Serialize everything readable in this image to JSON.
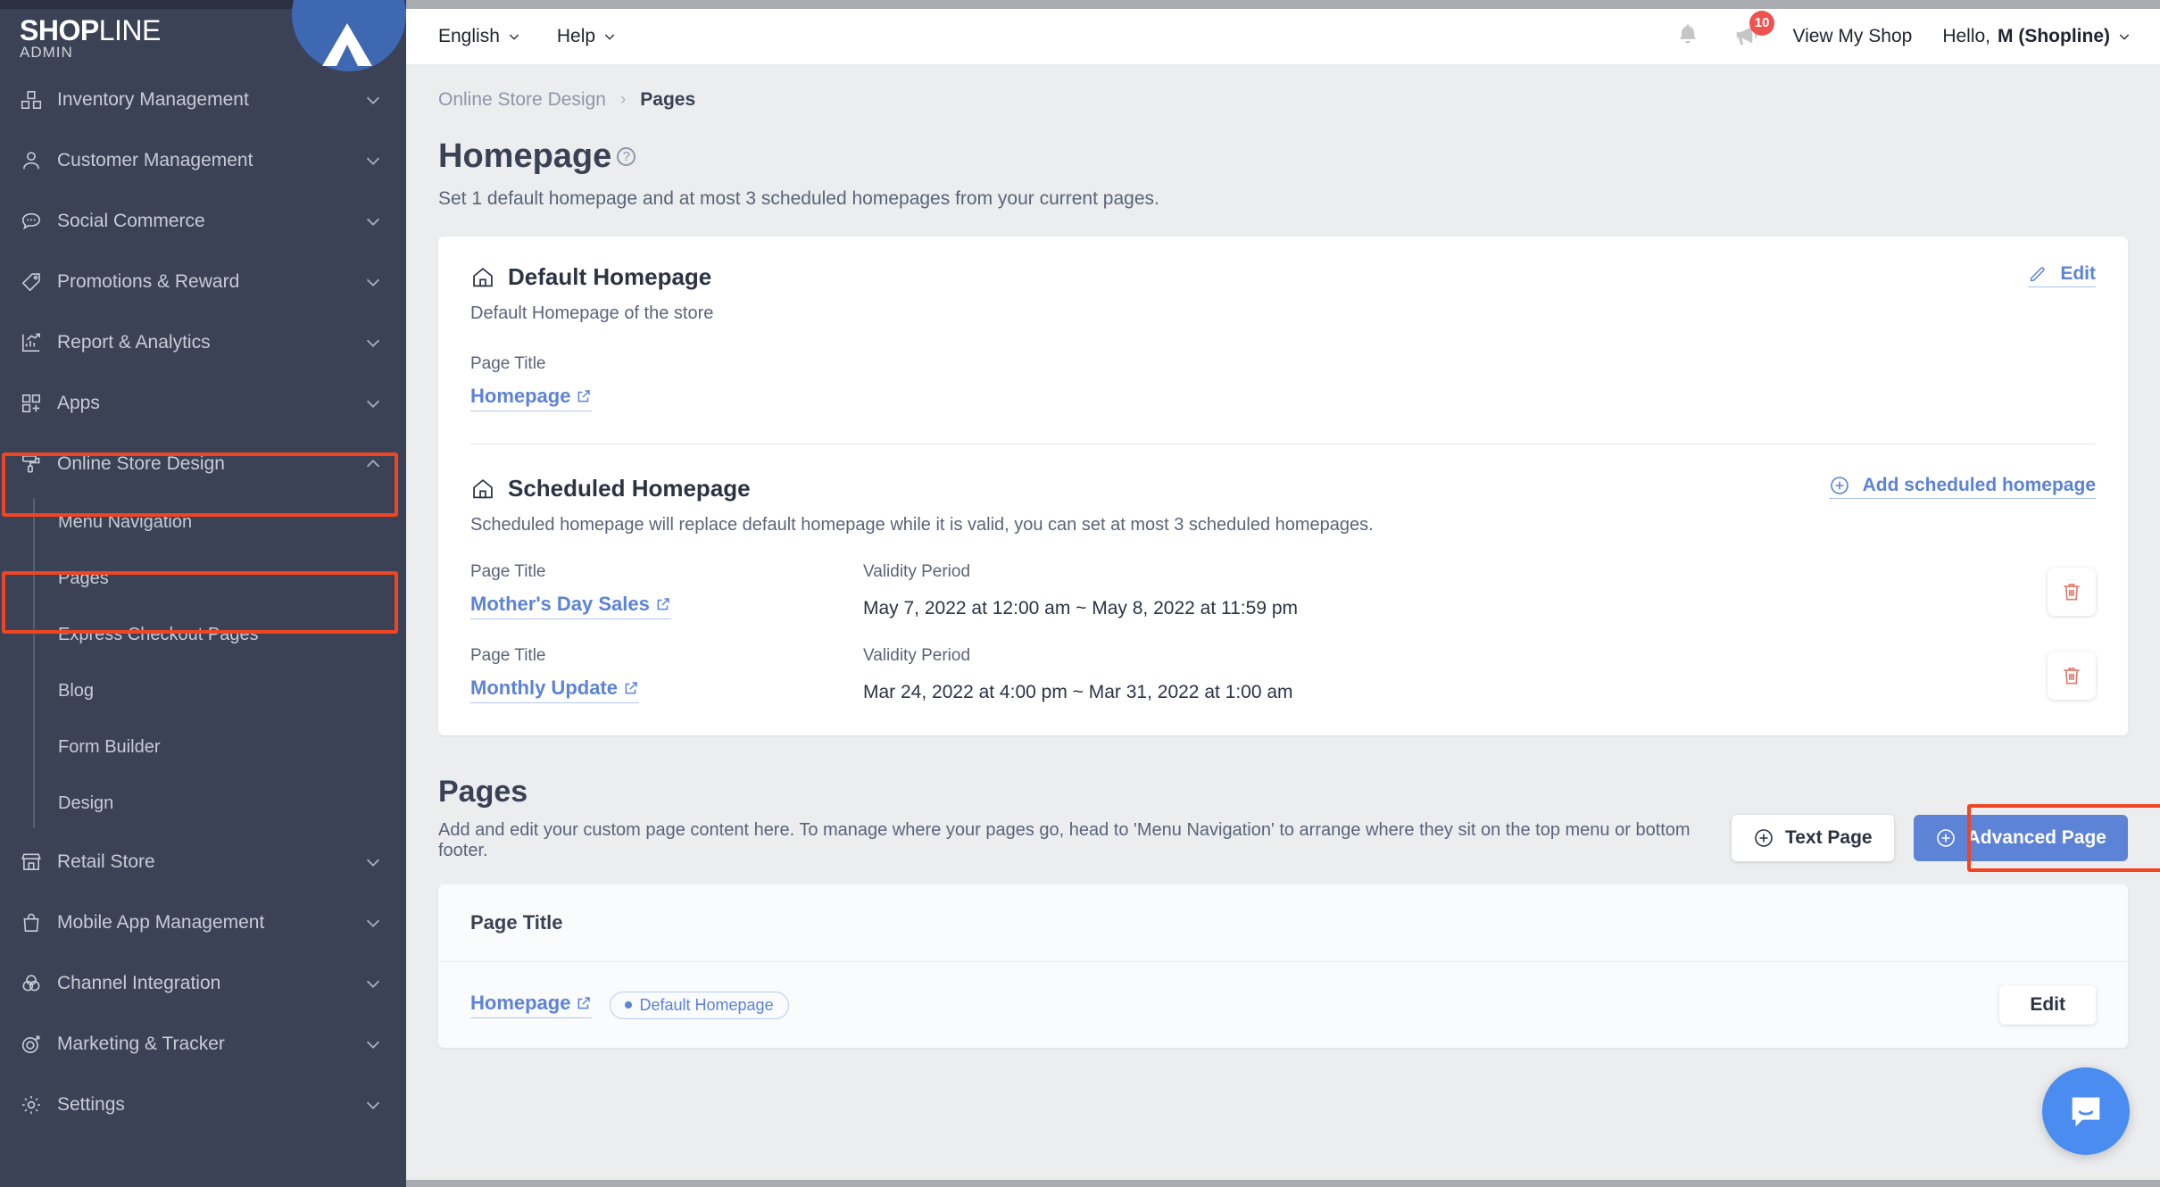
{
  "sidebar": {
    "logo": {
      "bold": "SH",
      "o": "O",
      "bold2": "P",
      "light": "LINE",
      "sub": "ADMIN"
    },
    "items": [
      {
        "label": "Inventory Management",
        "icon": "boxes-icon",
        "expanded": false
      },
      {
        "label": "Customer Management",
        "icon": "user-icon",
        "expanded": false
      },
      {
        "label": "Social Commerce",
        "icon": "chat-icon",
        "expanded": false
      },
      {
        "label": "Promotions & Reward",
        "icon": "tag-icon",
        "expanded": false
      },
      {
        "label": "Report & Analytics",
        "icon": "chart-icon",
        "expanded": false
      },
      {
        "label": "Apps",
        "icon": "apps-icon",
        "expanded": false
      },
      {
        "label": "Online Store Design",
        "icon": "paint-roller-icon",
        "expanded": true
      },
      {
        "label": "Retail Store",
        "icon": "store-icon",
        "expanded": false
      },
      {
        "label": "Mobile App Management",
        "icon": "bag-icon",
        "expanded": false
      },
      {
        "label": "Channel Integration",
        "icon": "venn-icon",
        "expanded": false
      },
      {
        "label": "Marketing & Tracker",
        "icon": "target-icon",
        "expanded": false
      },
      {
        "label": "Settings",
        "icon": "gear-icon",
        "expanded": false
      }
    ],
    "sub_items": [
      {
        "label": "Menu Navigation"
      },
      {
        "label": "Pages"
      },
      {
        "label": "Express Checkout Pages"
      },
      {
        "label": "Blog"
      },
      {
        "label": "Form Builder"
      },
      {
        "label": "Design"
      }
    ],
    "highlight_color": "#f04422"
  },
  "header": {
    "language": "English",
    "help": "Help",
    "notification_count": "10",
    "view_my_shop": "View My Shop",
    "greeting_prefix": "Hello, ",
    "account_name": "M (Shopline)"
  },
  "breadcrumb": {
    "parent": "Online Store Design",
    "separator": "›",
    "current": "Pages"
  },
  "page": {
    "title": "Homepage",
    "subtitle": "Set 1 default homepage and at most 3 scheduled homepages from your current pages."
  },
  "default_homepage": {
    "title": "Default Homepage",
    "description": "Default Homepage of the store",
    "field_label": "Page Title",
    "page_title": "Homepage",
    "edit_label": "Edit"
  },
  "scheduled_homepage": {
    "title": "Scheduled Homepage",
    "description": "Scheduled homepage will replace default homepage while it is valid, you can set at most 3 scheduled homepages.",
    "add_label": "Add scheduled homepage",
    "col_title_label": "Page Title",
    "col_validity_label": "Validity Period",
    "rows": [
      {
        "page_title": "Mother's Day Sales",
        "validity": "May 7, 2022 at 12:00 am ~ May 8, 2022 at 11:59 pm"
      },
      {
        "page_title": "Monthly Update",
        "validity": "Mar 24, 2022 at 4:00 pm ~ Mar 31, 2022 at 1:00 am"
      }
    ]
  },
  "pages_section": {
    "title": "Pages",
    "description": "Add and edit your custom page content here. To manage where your pages go, head to 'Menu Navigation' to arrange where they sit on the top menu or bottom footer.",
    "text_page_button": "Text Page",
    "advanced_page_button": "Advanced Page",
    "table_header": "Page Title",
    "rows": [
      {
        "page_title": "Homepage",
        "tag": "Default Homepage",
        "edit_label": "Edit"
      }
    ]
  },
  "colors": {
    "sidebar_bg": "#3b4256",
    "accent_blue": "#5c83d6",
    "highlight_red": "#f04422",
    "badge_red": "#ef5350",
    "chat_blue": "#4a8cf0"
  }
}
